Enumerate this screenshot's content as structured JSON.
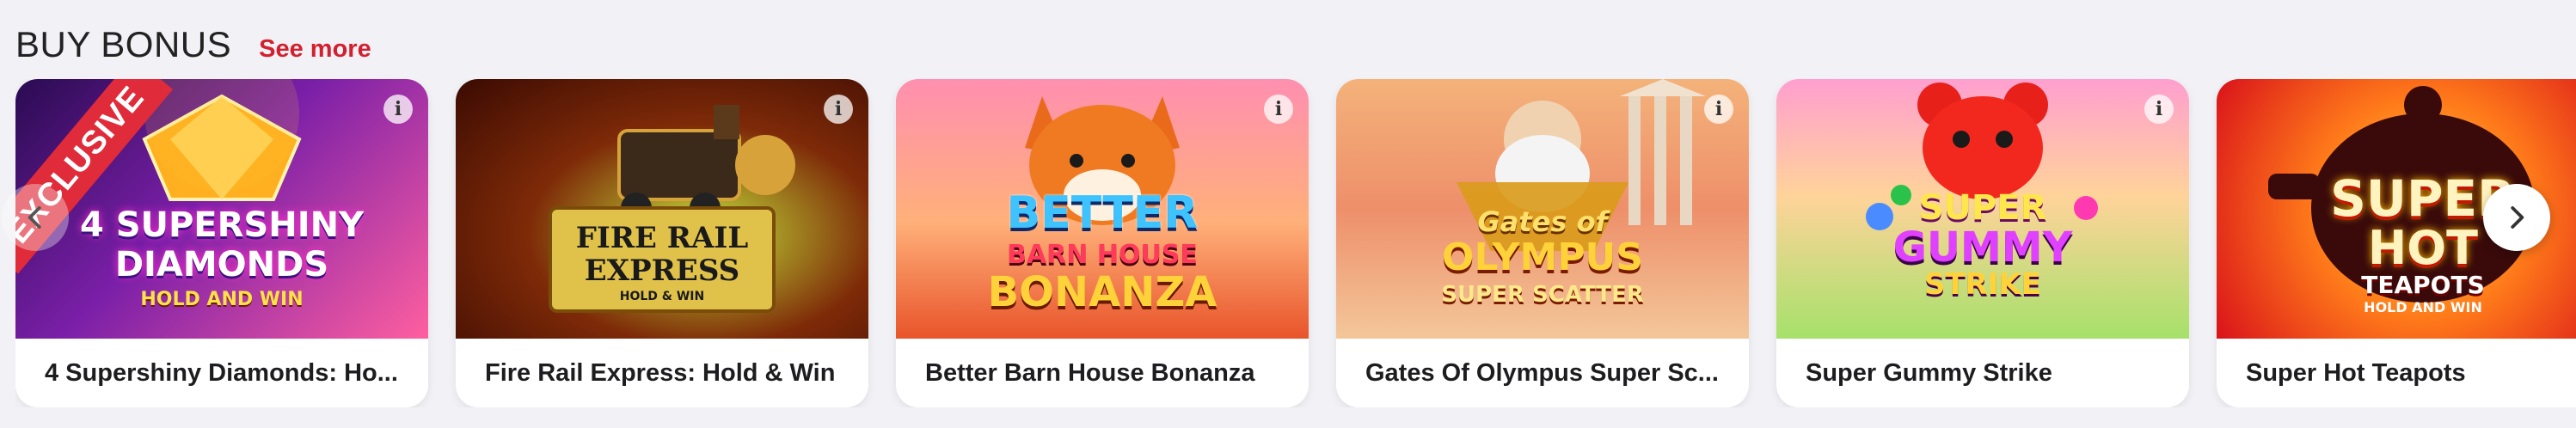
{
  "section": {
    "title": "BUY BONUS",
    "see_more": "See more",
    "accent": "#d3202f"
  },
  "info_glyph": "i",
  "cards": [
    {
      "name": "4 Supershiny Diamonds: Ho...",
      "badge": "EXCLUSIVE",
      "logo": [
        "4 SUPERSHINY",
        "DIAMONDS",
        "HOLD AND WIN"
      ]
    },
    {
      "name": "Fire Rail Express: Hold & Win",
      "logo": [
        "FIRE RAIL",
        "EXPRESS",
        "HOLD & WIN"
      ]
    },
    {
      "name": "Better Barn House Bonanza",
      "logo": [
        "BETTER",
        "BARN HOUSE",
        "BONANZA"
      ]
    },
    {
      "name": "Gates Of Olympus Super Sc...",
      "logo": [
        "Gates of",
        "OLYMPUS",
        "SUPER SCATTER"
      ]
    },
    {
      "name": "Super Gummy Strike",
      "logo": [
        "SUPER",
        "GUMMY",
        "STRIKE"
      ]
    },
    {
      "name": "Super Hot Teapots",
      "logo": [
        "SUPER",
        "HOT",
        "TEAPOTS",
        "HOLD AND WIN"
      ]
    }
  ],
  "icons": {
    "prev": "chevron-left-icon",
    "next": "chevron-right-icon",
    "info": "info-icon"
  }
}
